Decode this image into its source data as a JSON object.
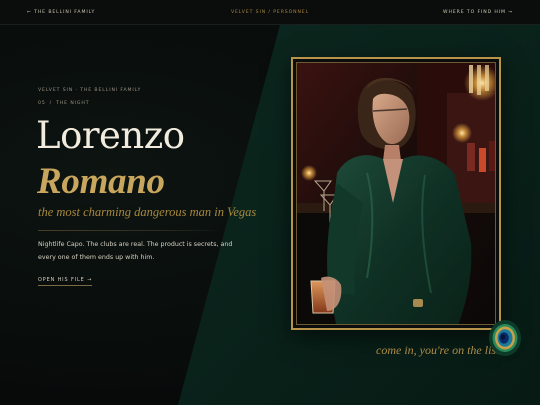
{
  "nav": {
    "back_label": "← THE BELLINI FAMILY",
    "section_label": "VELVET SIN / PERSONNEL",
    "location_label": "WHERE TO FIND HIM →"
  },
  "profile": {
    "eyebrow": "VELVET SIN · THE BELLINI FAMILY",
    "number": "05",
    "separator": "/",
    "time": "THE NIGHT",
    "first_name": "Lorenzo",
    "last_name": "Romano",
    "tagline": "the most charming dangerous man in Vegas",
    "description": "Nightlife Capo. The clubs are real. The product is secrets, and every one of them ends up with him.",
    "cta_label": "OPEN HIS FILE →"
  },
  "portrait": {
    "caption": "come in, you're on the list"
  },
  "icons": {
    "emblem": "peacock-feather-icon"
  },
  "colors": {
    "accent_gold": "#c9a65e",
    "panel_green": "#0e2a22",
    "background": "#070a09"
  }
}
